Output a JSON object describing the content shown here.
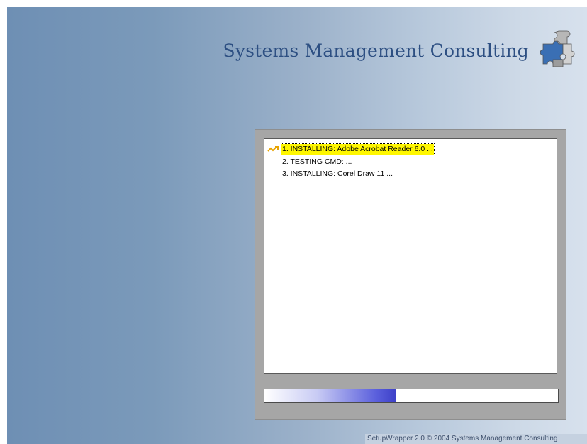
{
  "brand": {
    "title": "Systems Management Consulting",
    "logo_icon": "puzzle-pieces-icon"
  },
  "tasks": [
    {
      "label": "1. INSTALLING: Adobe Acrobat Reader 6.0 ...",
      "status": "active",
      "icon": "in-progress-arrow-icon"
    },
    {
      "label": "2. TESTING CMD: ...",
      "status": "pending"
    },
    {
      "label": "3. INSTALLING: Corel Draw 11 ...",
      "status": "pending"
    }
  ],
  "progress": {
    "fraction": 0.45
  },
  "footer": {
    "text": "SetupWrapper 2.0 © 2004 Systems Management Consulting"
  },
  "colors": {
    "highlight": "#fff700",
    "progress": "#3d40c8",
    "brand_text": "#2d4f82"
  }
}
